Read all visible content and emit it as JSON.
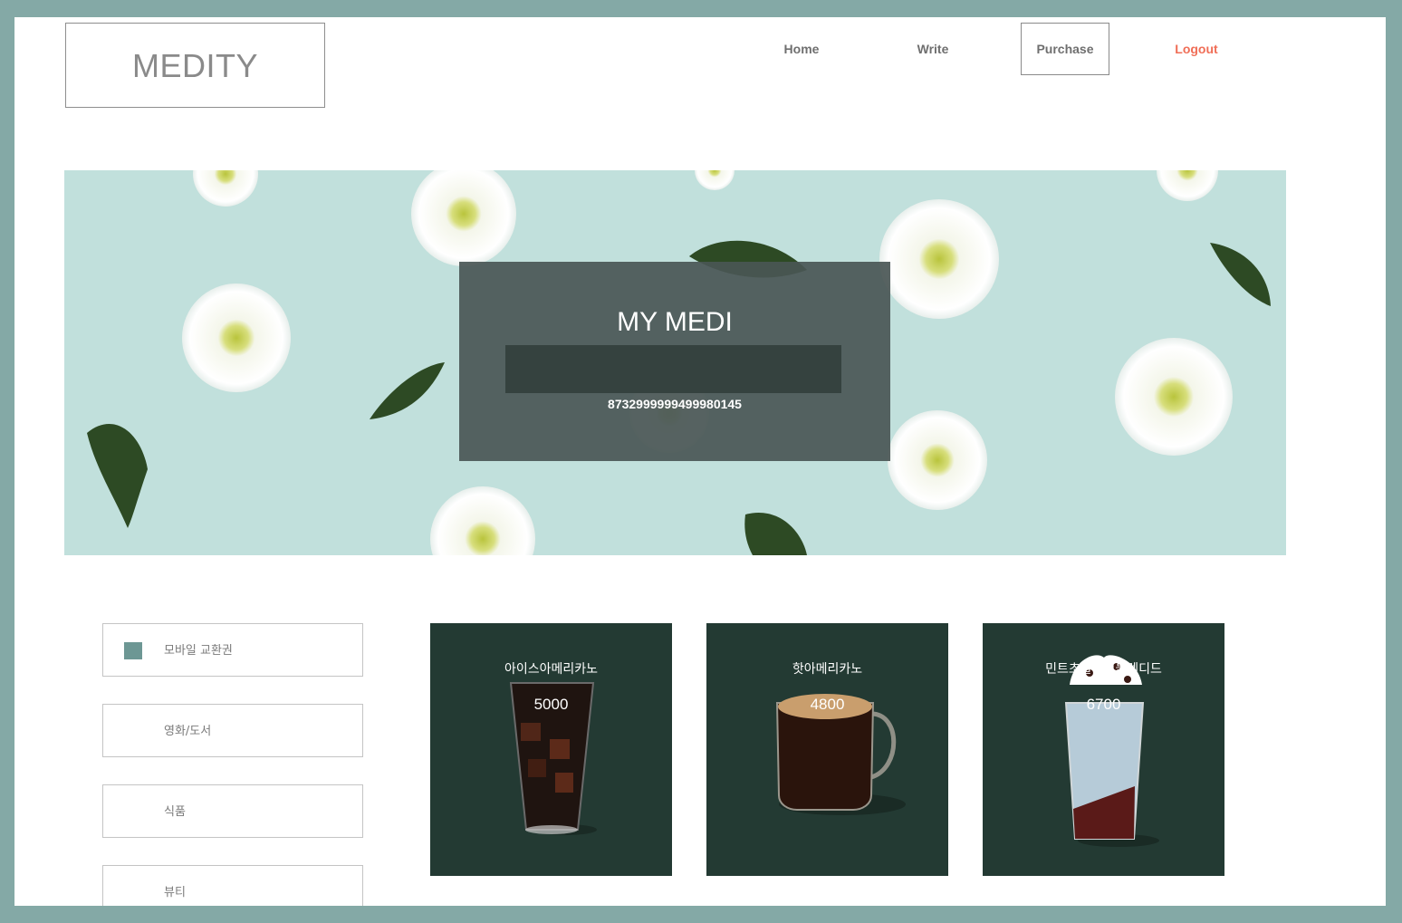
{
  "header": {
    "logo": "MEDITY",
    "nav": {
      "home": "Home",
      "write": "Write",
      "purchase": "Purchase",
      "logout": "Logout"
    }
  },
  "hero": {
    "title": "MY MEDI",
    "input_value": "",
    "number": "8732999999499980145"
  },
  "categories": [
    {
      "label": "모바일 교환권",
      "selected": true
    },
    {
      "label": "영화/도서",
      "selected": false
    },
    {
      "label": "식품",
      "selected": false
    },
    {
      "label": "뷰티",
      "selected": false
    }
  ],
  "products": [
    {
      "name": "아이스아메리카노",
      "price": "5000",
      "image": "iced-americano-image"
    },
    {
      "name": "핫아메리카노",
      "price": "4800",
      "image": "hot-americano-image"
    },
    {
      "name": "민트초콜릿칩블렌디드",
      "price": "6700",
      "image": "mint-chocolate-chip-blended-image"
    }
  ],
  "colors": {
    "frame": "#84a9a6",
    "hero_bg": "#c1e0dc",
    "hero_box": "#4a5655",
    "card_bg": "#233a33",
    "logout": "#f06e57",
    "category_swatch": "#6d9794"
  }
}
